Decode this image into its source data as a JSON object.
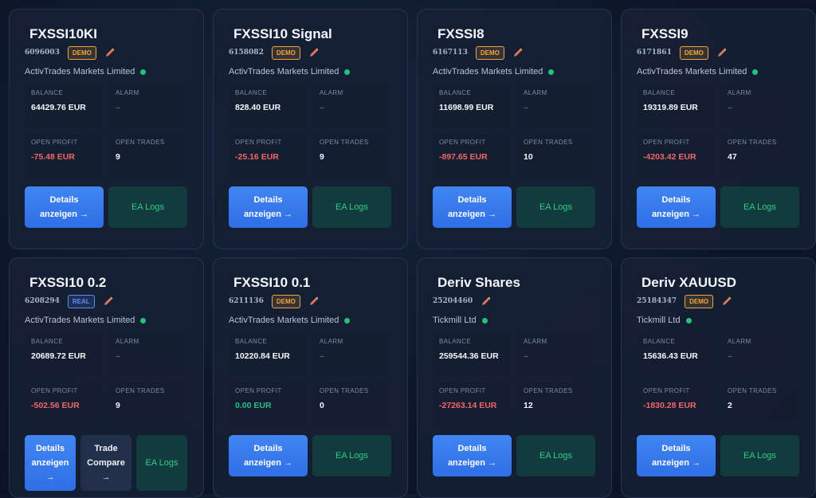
{
  "labels": {
    "balance": "BALANCE",
    "alarm": "ALARM",
    "open_profit": "OPEN PROFIT",
    "open_trades": "OPEN TRADES",
    "details_line1": "Details",
    "details_line2": "anzeigen →",
    "details_alt_line2": "anzeigen",
    "details_alt_line3": "→",
    "trade_line1": "Trade",
    "trade_line2": "Compare",
    "trade_line3": "→",
    "ea_logs": "EA Logs"
  },
  "accounts": [
    {
      "name": "FXSSI10KI",
      "id": "6096003",
      "badge": "DEMO",
      "broker": "ActivTrades Markets Limited",
      "balance": "64429.76 EUR",
      "alarm": "–",
      "open_profit": "-75.48 EUR",
      "open_trades": "9"
    },
    {
      "name": "FXSSI10 Signal",
      "id": "6158082",
      "badge": "DEMO",
      "broker": "ActivTrades Markets Limited",
      "balance": "828.40 EUR",
      "alarm": "–",
      "open_profit": "-25.16 EUR",
      "open_trades": "9"
    },
    {
      "name": "FXSSI8",
      "id": "6167113",
      "badge": "DEMO",
      "broker": "ActivTrades Markets Limited",
      "balance": "11698.99 EUR",
      "alarm": "–",
      "open_profit": "-897.65 EUR",
      "open_trades": "10"
    },
    {
      "name": "FXSSI9",
      "id": "6171861",
      "badge": "DEMO",
      "broker": "ActivTrades Markets Limited",
      "balance": "19319.89 EUR",
      "alarm": "–",
      "open_profit": "-4203.42 EUR",
      "open_trades": "47"
    },
    {
      "name": "FXSSI10 0.2",
      "id": "6208294",
      "badge": "REAL",
      "broker": "ActivTrades Markets Limited",
      "balance": "20689.72 EUR",
      "alarm": "–",
      "open_profit": "-502.56 EUR",
      "open_trades": "9"
    },
    {
      "name": "FXSSI10 0.1",
      "id": "6211136",
      "badge": "DEMO",
      "broker": "ActivTrades Markets Limited",
      "balance": "10220.84 EUR",
      "alarm": "–",
      "open_profit": "0.00 EUR",
      "open_trades": "0"
    },
    {
      "name": "Deriv Shares",
      "id": "25204460",
      "badge": "",
      "broker": "Tickmill Ltd",
      "balance": "259544.36 EUR",
      "alarm": "–",
      "open_profit": "-27263.14 EUR",
      "open_trades": "12"
    },
    {
      "name": "Deriv XAUUSD",
      "id": "25184347",
      "badge": "DEMO",
      "broker": "Tickmill Ltd",
      "balance": "15636.43 EUR",
      "alarm": "–",
      "open_profit": "-1830.28 EUR",
      "open_trades": "2"
    }
  ],
  "colors": {
    "demo_badge": "#f0a53a",
    "real_badge": "#5a8dff",
    "negative": "#f06767",
    "zero": "#2bbf85",
    "online_dot": "#22c47a",
    "primary_button": "#3a7df0",
    "logs_text": "#2fcc8a"
  },
  "icons": {
    "edit": "pencil-icon",
    "status": "online-status-dot"
  }
}
